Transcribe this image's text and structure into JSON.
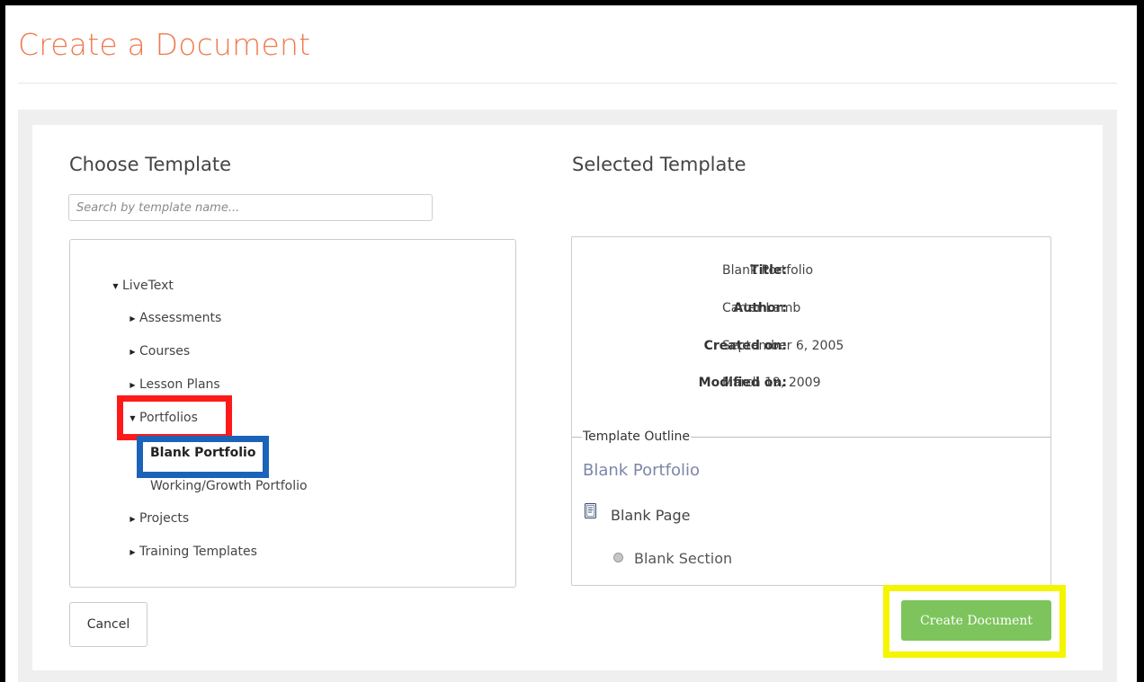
{
  "page": {
    "title": "Create a Document"
  },
  "left": {
    "heading": "Choose Template",
    "search_placeholder": "Search by template name...",
    "tree": {
      "root": "LiveText",
      "items": [
        {
          "label": "Assessments",
          "expanded": false
        },
        {
          "label": "Courses",
          "expanded": false
        },
        {
          "label": "Lesson Plans",
          "expanded": false
        },
        {
          "label": "Portfolios",
          "expanded": true,
          "children": [
            {
              "label": "Blank Portfolio",
              "selected": true
            },
            {
              "label": "Working/Growth Portfolio",
              "selected": false
            }
          ]
        },
        {
          "label": "Projects",
          "expanded": false
        },
        {
          "label": "Training Templates",
          "expanded": false
        }
      ]
    },
    "cancel_label": "Cancel"
  },
  "right": {
    "heading": "Selected Template",
    "meta": {
      "title_label": "Title:",
      "title_value": "Blank Portfolio",
      "author_label": "Author:",
      "author_value": "Carter Lamb",
      "created_label": "Created on:",
      "created_value": "September 6, 2005",
      "modified_label": "Modified on:",
      "modified_value": "March 19, 2009"
    },
    "outline": {
      "legend": "Template Outline",
      "title": "Blank Portfolio",
      "page": "Blank Page",
      "section": "Blank Section"
    },
    "create_label": "Create Document"
  },
  "colors": {
    "title_accent": "#ee7a4f",
    "create_button": "#7dc45d",
    "highlight_red": "#ff1a1a",
    "highlight_blue": "#1a63b8",
    "highlight_yellow": "#f5f500"
  },
  "icons": {
    "expanded": "triangle-down",
    "collapsed": "triangle-right",
    "page": "document-page-icon",
    "section": "circle-bullet"
  }
}
